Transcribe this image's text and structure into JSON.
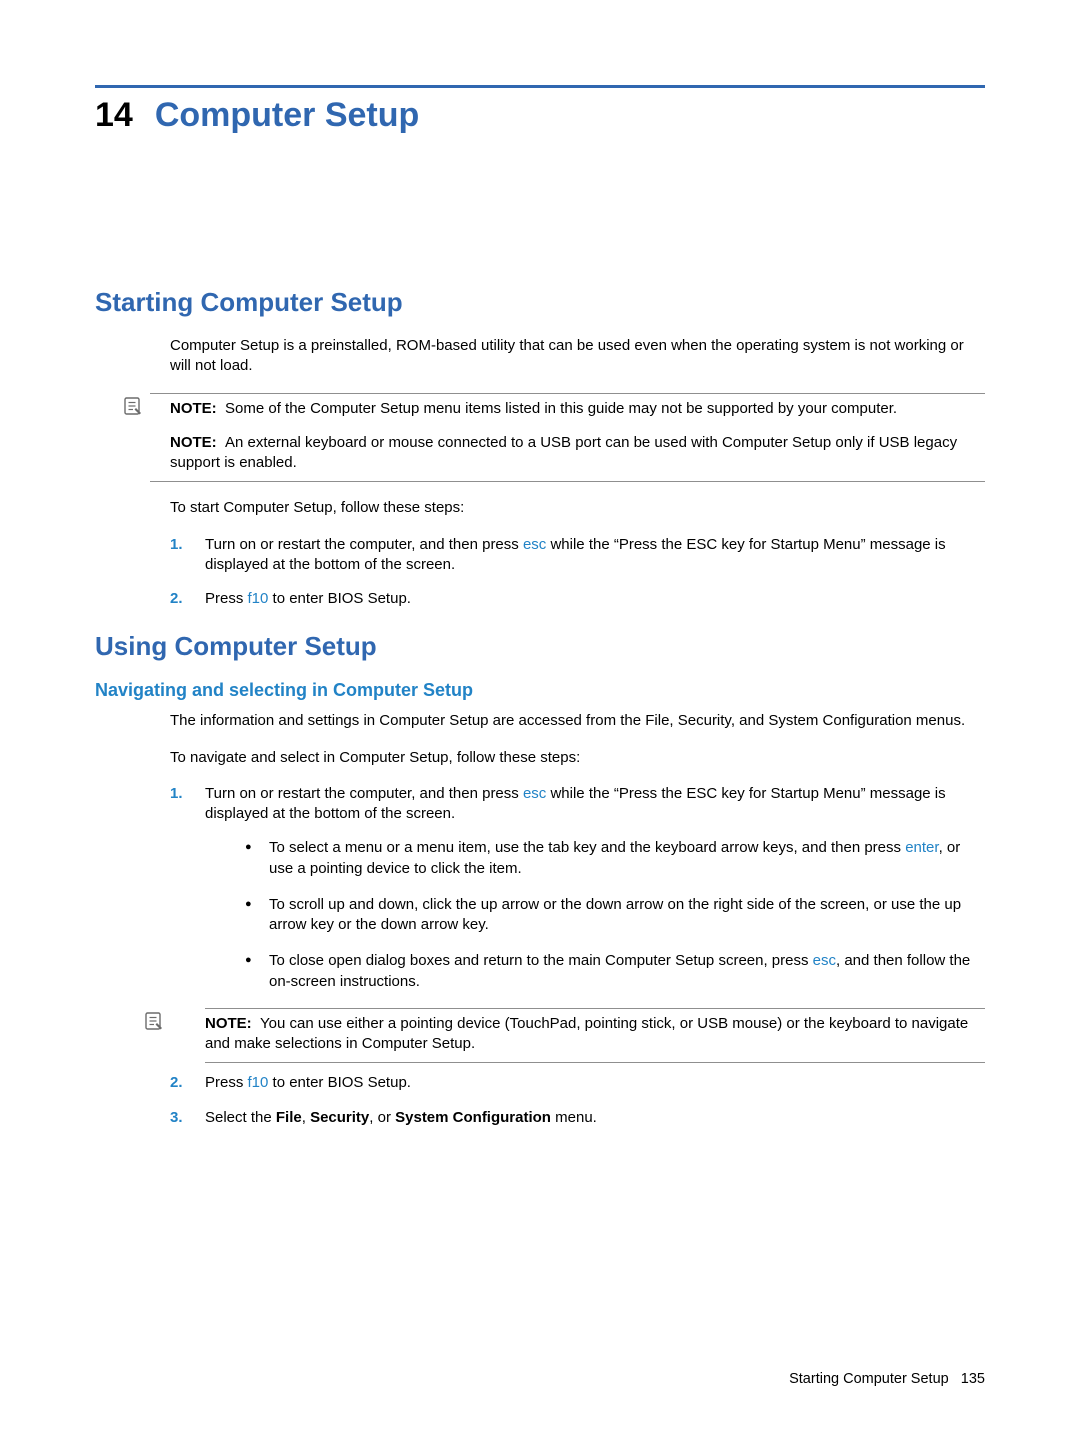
{
  "chapter": {
    "number": "14",
    "title": "Computer Setup"
  },
  "section1": {
    "heading": "Starting Computer Setup",
    "intro": "Computer Setup is a preinstalled, ROM-based utility that can be used even when the operating system is not working or will not load.",
    "note1_label": "NOTE:",
    "note1_text": "Some of the Computer Setup menu items listed in this guide may not be supported by your computer.",
    "note2_label": "NOTE:",
    "note2_text": "An external keyboard or mouse connected to a USB port can be used with Computer Setup only if USB legacy support is enabled.",
    "intro2": "To start Computer Setup, follow these steps:",
    "step1_a": "Turn on or restart the computer, and then press ",
    "step1_key": "esc",
    "step1_b": " while the “Press the ESC key for Startup Menu” message is displayed at the bottom of the screen.",
    "step2_a": "Press ",
    "step2_key": "f10",
    "step2_b": " to enter BIOS Setup."
  },
  "section2": {
    "heading": "Using Computer Setup",
    "sub_heading": "Navigating and selecting in Computer Setup",
    "intro": "The information and settings in Computer Setup are accessed from the File, Security, and System Configuration menus.",
    "intro2": "To navigate and select in Computer Setup, follow these steps:",
    "step1_a": "Turn on or restart the computer, and then press ",
    "step1_key": "esc",
    "step1_b": " while the “Press the ESC key for Startup Menu” message is displayed at the bottom of the screen.",
    "bullet1_a": "To select a menu or a menu item, use the tab key and the keyboard arrow keys, and then press ",
    "bullet1_key": "enter",
    "bullet1_b": ", or use a pointing device to click the item.",
    "bullet2": "To scroll up and down, click the up arrow or the down arrow on the right side of the screen, or use the up arrow key or the down arrow key.",
    "bullet3_a": "To close open dialog boxes and return to the main Computer Setup screen, press ",
    "bullet3_key": "esc",
    "bullet3_b": ", and then follow the on-screen instructions.",
    "note_label": "NOTE:",
    "note_text": "You can use either a pointing device (TouchPad, pointing stick, or USB mouse) or the keyboard to navigate and make selections in Computer Setup.",
    "step2_a": "Press ",
    "step2_key": "f10",
    "step2_b": " to enter BIOS Setup.",
    "step3_a": "Select the ",
    "step3_b1": "File",
    "step3_c1": ", ",
    "step3_b2": "Security",
    "step3_c2": ", or ",
    "step3_b3": "System Configuration",
    "step3_c3": " menu."
  },
  "footer": {
    "text": "Starting Computer Setup",
    "page": "135"
  }
}
